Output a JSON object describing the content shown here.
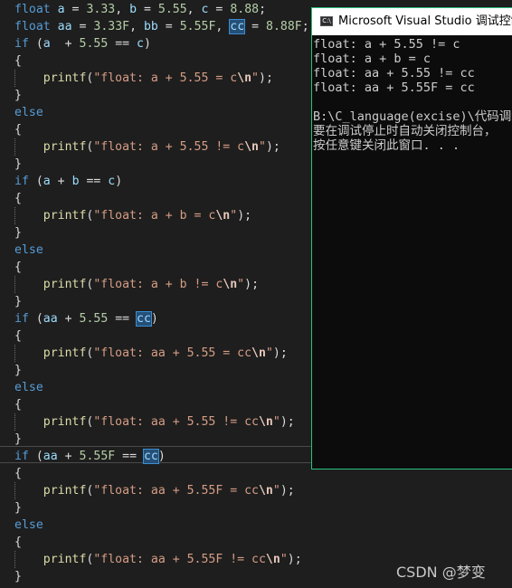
{
  "editor": {
    "lines": [
      [
        [
          "kw",
          "float"
        ],
        [
          "p",
          " "
        ],
        [
          "var",
          "a"
        ],
        [
          "p",
          " = "
        ],
        [
          "num",
          "3.33"
        ],
        [
          "p",
          ", "
        ],
        [
          "var",
          "b"
        ],
        [
          "p",
          " = "
        ],
        [
          "num",
          "5.55"
        ],
        [
          "p",
          ", "
        ],
        [
          "var",
          "c"
        ],
        [
          "p",
          " = "
        ],
        [
          "num",
          "8.88"
        ],
        [
          "p",
          ";"
        ]
      ],
      [
        [
          "kw",
          "float"
        ],
        [
          "p",
          " "
        ],
        [
          "var",
          "aa"
        ],
        [
          "p",
          " = "
        ],
        [
          "num",
          "3.33F"
        ],
        [
          "p",
          ", "
        ],
        [
          "var",
          "bb"
        ],
        [
          "p",
          " = "
        ],
        [
          "num",
          "5.55F"
        ],
        [
          "p",
          ", "
        ],
        [
          "hl",
          "cc"
        ],
        [
          "p",
          " = "
        ],
        [
          "num",
          "8.88F"
        ],
        [
          "p",
          ";"
        ]
      ],
      [
        [
          "kw",
          "if"
        ],
        [
          "p",
          " ("
        ],
        [
          "var",
          "a"
        ],
        [
          "p",
          "  + "
        ],
        [
          "num",
          "5.55"
        ],
        [
          "p",
          " == "
        ],
        [
          "var",
          "c"
        ],
        [
          "p",
          ")"
        ]
      ],
      [
        [
          "p",
          "{"
        ]
      ],
      [
        [
          "p",
          "    "
        ],
        [
          "fn",
          "printf"
        ],
        [
          "p",
          "("
        ],
        [
          "str",
          "\"float: a + 5.55 = c"
        ],
        [
          "esc",
          "\\n"
        ],
        [
          "str",
          "\""
        ],
        [
          "p",
          ");"
        ]
      ],
      [
        [
          "p",
          "}"
        ]
      ],
      [
        [
          "kw",
          "else"
        ]
      ],
      [
        [
          "p",
          "{"
        ]
      ],
      [
        [
          "p",
          "    "
        ],
        [
          "fn",
          "printf"
        ],
        [
          "p",
          "("
        ],
        [
          "str",
          "\"float: a + 5.55 != c"
        ],
        [
          "esc",
          "\\n"
        ],
        [
          "str",
          "\""
        ],
        [
          "p",
          ");"
        ]
      ],
      [
        [
          "p",
          "}"
        ]
      ],
      [
        [
          "kw",
          "if"
        ],
        [
          "p",
          " ("
        ],
        [
          "var",
          "a"
        ],
        [
          "p",
          " + "
        ],
        [
          "var",
          "b"
        ],
        [
          "p",
          " == "
        ],
        [
          "var",
          "c"
        ],
        [
          "p",
          ")"
        ]
      ],
      [
        [
          "p",
          "{"
        ]
      ],
      [
        [
          "p",
          "    "
        ],
        [
          "fn",
          "printf"
        ],
        [
          "p",
          "("
        ],
        [
          "str",
          "\"float: a + b = c"
        ],
        [
          "esc",
          "\\n"
        ],
        [
          "str",
          "\""
        ],
        [
          "p",
          ");"
        ]
      ],
      [
        [
          "p",
          "}"
        ]
      ],
      [
        [
          "kw",
          "else"
        ]
      ],
      [
        [
          "p",
          "{"
        ]
      ],
      [
        [
          "p",
          "    "
        ],
        [
          "fn",
          "printf"
        ],
        [
          "p",
          "("
        ],
        [
          "str",
          "\"float: a + b != c"
        ],
        [
          "esc",
          "\\n"
        ],
        [
          "str",
          "\""
        ],
        [
          "p",
          ");"
        ]
      ],
      [
        [
          "p",
          "}"
        ]
      ],
      [
        [
          "kw",
          "if"
        ],
        [
          "p",
          " ("
        ],
        [
          "var",
          "aa"
        ],
        [
          "p",
          " + "
        ],
        [
          "num",
          "5.55"
        ],
        [
          "p",
          " == "
        ],
        [
          "hl",
          "cc"
        ],
        [
          "p",
          ")"
        ]
      ],
      [
        [
          "p",
          "{"
        ]
      ],
      [
        [
          "p",
          "    "
        ],
        [
          "fn",
          "printf"
        ],
        [
          "p",
          "("
        ],
        [
          "str",
          "\"float: aa + 5.55 = cc"
        ],
        [
          "esc",
          "\\n"
        ],
        [
          "str",
          "\""
        ],
        [
          "p",
          ");"
        ]
      ],
      [
        [
          "p",
          "}"
        ]
      ],
      [
        [
          "kw",
          "else"
        ]
      ],
      [
        [
          "p",
          "{"
        ]
      ],
      [
        [
          "p",
          "    "
        ],
        [
          "fn",
          "printf"
        ],
        [
          "p",
          "("
        ],
        [
          "str",
          "\"float: aa + 5.55 != cc"
        ],
        [
          "esc",
          "\\n"
        ],
        [
          "str",
          "\""
        ],
        [
          "p",
          ");"
        ]
      ],
      [
        [
          "p",
          "}"
        ]
      ],
      [
        [
          "kw",
          "if"
        ],
        [
          "p",
          " ("
        ],
        [
          "var",
          "aa"
        ],
        [
          "p",
          " + "
        ],
        [
          "num",
          "5.55F"
        ],
        [
          "p",
          " == "
        ],
        [
          "hl",
          "cc"
        ],
        [
          "p",
          ")"
        ]
      ],
      [
        [
          "p",
          "{"
        ]
      ],
      [
        [
          "p",
          "    "
        ],
        [
          "fn",
          "printf"
        ],
        [
          "p",
          "("
        ],
        [
          "str",
          "\"float: aa + 5.55F = cc"
        ],
        [
          "esc",
          "\\n"
        ],
        [
          "str",
          "\""
        ],
        [
          "p",
          ");"
        ]
      ],
      [
        [
          "p",
          "}"
        ]
      ],
      [
        [
          "kw",
          "else"
        ]
      ],
      [
        [
          "p",
          "{"
        ]
      ],
      [
        [
          "p",
          "    "
        ],
        [
          "fn",
          "printf"
        ],
        [
          "p",
          "("
        ],
        [
          "str",
          "\"float: aa + 5.55F != cc"
        ],
        [
          "esc",
          "\\n"
        ],
        [
          "str",
          "\""
        ],
        [
          "p",
          ");"
        ]
      ],
      [
        [
          "p",
          "}"
        ]
      ]
    ]
  },
  "console": {
    "app_icon": "C:\\",
    "title": "Microsoft Visual Studio 调试控制台",
    "output_lines": [
      "float: a + 5.55 != c",
      "float: a + b = c",
      "float: aa + 5.55 != cc",
      "float: aa + 5.55F = cc",
      "",
      "B:\\C_language(excise)\\代码调试\\",
      "要在调试停止时自动关闭控制台，",
      "按任意键关闭此窗口. . ."
    ]
  },
  "watermark": "CSDN @梦变",
  "colors": {
    "editor_bg": "#1e1e1e",
    "keyword": "#569cd6",
    "variable": "#9cdcfe",
    "number": "#b5cea8",
    "function": "#dcdcaa",
    "string": "#d69d85",
    "console_bg": "#0c0c0c",
    "console_border": "#2bbf7f"
  }
}
